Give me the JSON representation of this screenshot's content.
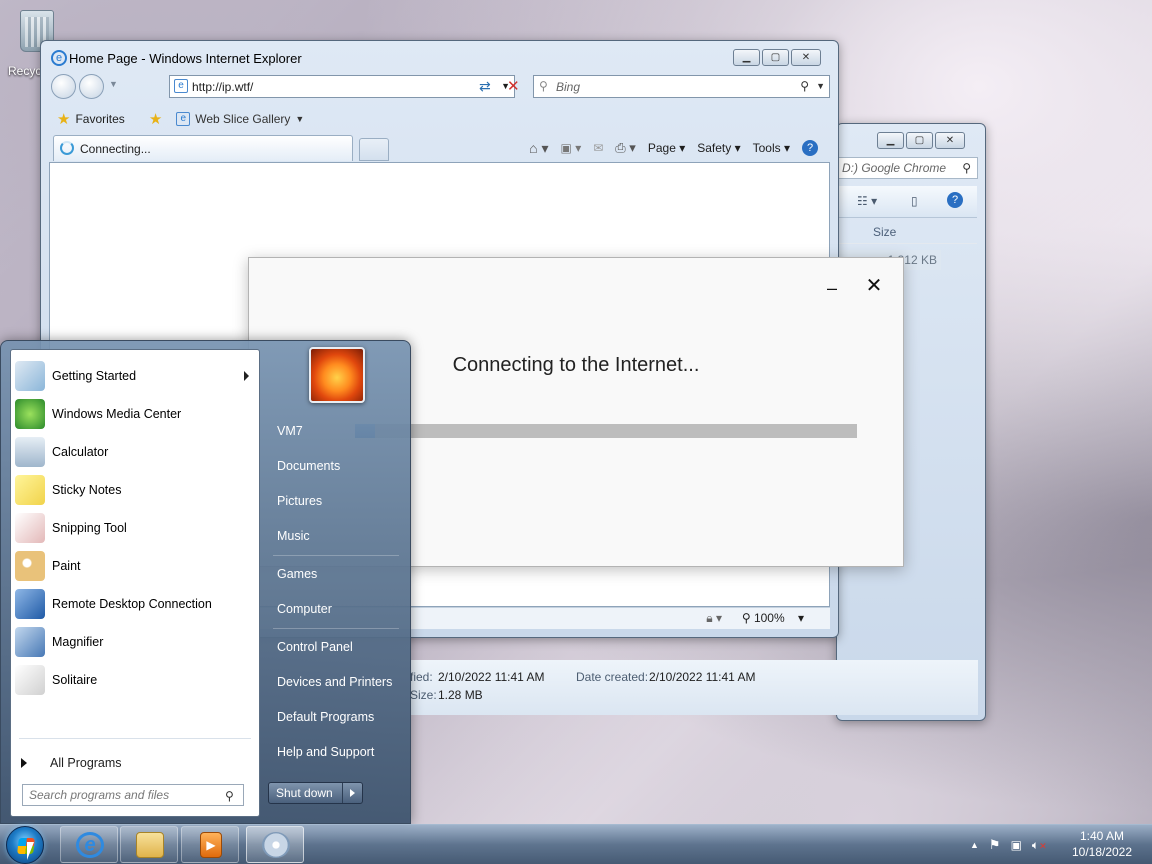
{
  "desktop": {
    "recycle_bin_label": "Recyc"
  },
  "explorer_window": {
    "search_placeholder": "D:) Google Chrome",
    "column_size": "Size",
    "size_value": "1,312 KB",
    "details": {
      "date_modified_label": "fied:",
      "date_modified_value": "2/10/2022 11:41 AM",
      "date_created_label": "Date created:",
      "date_created_value": "2/10/2022 11:41 AM",
      "size_label": "Size:",
      "size_value": "1.28 MB"
    }
  },
  "ie_window": {
    "title": "Home Page - Windows Internet Explorer",
    "address": "http://ip.wtf/",
    "search_placeholder": "Bing",
    "favorites_label": "Favorites",
    "web_slice_label": "Web Slice Gallery",
    "tab_label": "Connecting...",
    "commands": {
      "page": "Page",
      "safety": "Safety",
      "tools": "Tools"
    },
    "zoom": "100%"
  },
  "dialog": {
    "title": "Connecting to the Internet...",
    "progress": 0.04,
    "accent": "#2f7ed8"
  },
  "start_menu": {
    "programs": [
      {
        "label": "Getting Started",
        "icon": "getting-started-icon",
        "has_submenu": true
      },
      {
        "label": "Windows Media Center",
        "icon": "media-center-icon",
        "has_submenu": false
      },
      {
        "label": "Calculator",
        "icon": "calculator-icon",
        "has_submenu": false
      },
      {
        "label": "Sticky Notes",
        "icon": "sticky-notes-icon",
        "has_submenu": false
      },
      {
        "label": "Snipping Tool",
        "icon": "snipping-tool-icon",
        "has_submenu": false
      },
      {
        "label": "Paint",
        "icon": "paint-icon",
        "has_submenu": false
      },
      {
        "label": "Remote Desktop Connection",
        "icon": "remote-desktop-icon",
        "has_submenu": false
      },
      {
        "label": "Magnifier",
        "icon": "magnifier-icon",
        "has_submenu": false
      },
      {
        "label": "Solitaire",
        "icon": "solitaire-icon",
        "has_submenu": false
      }
    ],
    "all_programs": "All Programs",
    "search_placeholder": "Search programs and files",
    "right_links": [
      "VM7",
      "Documents",
      "Pictures",
      "Music",
      "Games",
      "Computer",
      "Control Panel",
      "Devices and Printers",
      "Default Programs",
      "Help and Support"
    ],
    "shutdown_label": "Shut down"
  },
  "taskbar": {
    "time": "1:40 AM",
    "date": "10/18/2022"
  }
}
